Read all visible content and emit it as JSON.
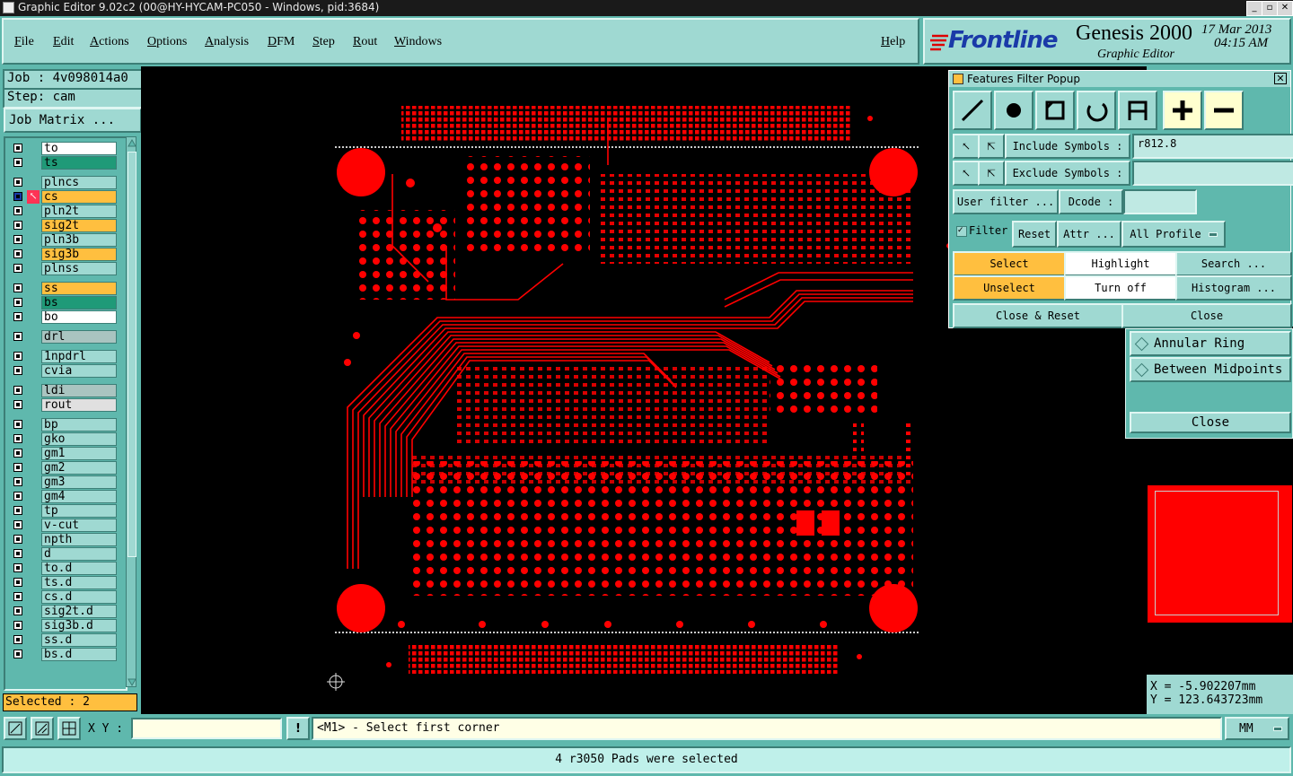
{
  "window": {
    "title": "Graphic Editor 9.02c2 (00@HY-HYCAM-PC050 - Windows, pid:3684)"
  },
  "menu": {
    "items": [
      "File",
      "Edit",
      "Actions",
      "Options",
      "Analysis",
      "DFM",
      "Step",
      "Rout",
      "Windows"
    ],
    "help": "Help"
  },
  "brand": {
    "logo": "Frontline",
    "product": "Genesis 2000",
    "subtitle": "Graphic Editor",
    "date": "17 Mar 2013",
    "time": "04:15 AM"
  },
  "job": {
    "job_label": "Job : 4v098014a0",
    "step_label": "Step: cam",
    "matrix_button": "Job Matrix ..."
  },
  "layers": [
    {
      "name": "to",
      "color": "#ffffff"
    },
    {
      "name": "ts",
      "color": "#1f9a78"
    },
    {
      "name": "plncs",
      "color": "#9fd9d2"
    },
    {
      "name": "cs",
      "color": "#ffbf3f",
      "active": true
    },
    {
      "name": "pln2t",
      "color": "#9fd9d2"
    },
    {
      "name": "sig2t",
      "color": "#ffbf3f"
    },
    {
      "name": "pln3b",
      "color": "#9fd9d2"
    },
    {
      "name": "sig3b",
      "color": "#ffbf3f"
    },
    {
      "name": "plnss",
      "color": "#9fd9d2"
    },
    {
      "name": "ss",
      "color": "#ffbf3f"
    },
    {
      "name": "bs",
      "color": "#1f9a78"
    },
    {
      "name": "bo",
      "color": "#ffffff"
    },
    {
      "name": "drl",
      "color": "#a9c4c0"
    },
    {
      "name": "1npdrl",
      "color": "#9fd9d2"
    },
    {
      "name": "cvia",
      "color": "#9fd9d2"
    },
    {
      "name": "ldi",
      "color": "#a9c4c0"
    },
    {
      "name": "rout",
      "color": "#e0e0e0"
    },
    {
      "name": "bp",
      "color": "#9fd9d2"
    },
    {
      "name": "gko",
      "color": "#9fd9d2"
    },
    {
      "name": "gm1",
      "color": "#9fd9d2"
    },
    {
      "name": "gm2",
      "color": "#9fd9d2"
    },
    {
      "name": "gm3",
      "color": "#9fd9d2"
    },
    {
      "name": "gm4",
      "color": "#9fd9d2"
    },
    {
      "name": "tp",
      "color": "#9fd9d2"
    },
    {
      "name": "v-cut",
      "color": "#9fd9d2"
    },
    {
      "name": "npth",
      "color": "#9fd9d2"
    },
    {
      "name": "d",
      "color": "#9fd9d2"
    },
    {
      "name": "to.d",
      "color": "#9fd9d2"
    },
    {
      "name": "ts.d",
      "color": "#9fd9d2"
    },
    {
      "name": "cs.d",
      "color": "#9fd9d2"
    },
    {
      "name": "sig2t.d",
      "color": "#9fd9d2"
    },
    {
      "name": "sig3b.d",
      "color": "#9fd9d2"
    },
    {
      "name": "ss.d",
      "color": "#9fd9d2"
    },
    {
      "name": "bs.d",
      "color": "#9fd9d2"
    }
  ],
  "selected_count": "Selected : 2",
  "filter_popup": {
    "title": "Features Filter Popup",
    "include_label": "Include Symbols :",
    "include_value": "r812.8",
    "exclude_label": "Exclude Symbols :",
    "exclude_value": "",
    "user_filter": "User filter ...",
    "dcode_label": "Dcode :",
    "dcode_value": "",
    "filter": "Filter",
    "reset": "Reset",
    "attr": "Attr ...",
    "profile": "All Profile",
    "select": "Select",
    "highlight": "Highlight",
    "search": "Search ...",
    "unselect": "Unselect",
    "turn_off": "Turn off",
    "histogram": "Histogram ...",
    "close_reset": "Close & Reset",
    "close": "Close"
  },
  "snap_panel": {
    "annular_ring": "Annular Ring",
    "between_midpoints": "Between Midpoints",
    "close": "Close"
  },
  "coords": {
    "x": "X  = -5.902207mm",
    "y": "Y  = 123.643723mm"
  },
  "command": {
    "xy_label": "X Y :",
    "xy_value": "",
    "prompt": "<M1> - Select first corner",
    "units": "MM"
  },
  "status_message": "4 r3050 Pads were selected",
  "colors": {
    "board": "#ff0000",
    "panel": "#5fb8ad",
    "button": "#9fd9d2",
    "highlight": "#ffbf3f"
  }
}
